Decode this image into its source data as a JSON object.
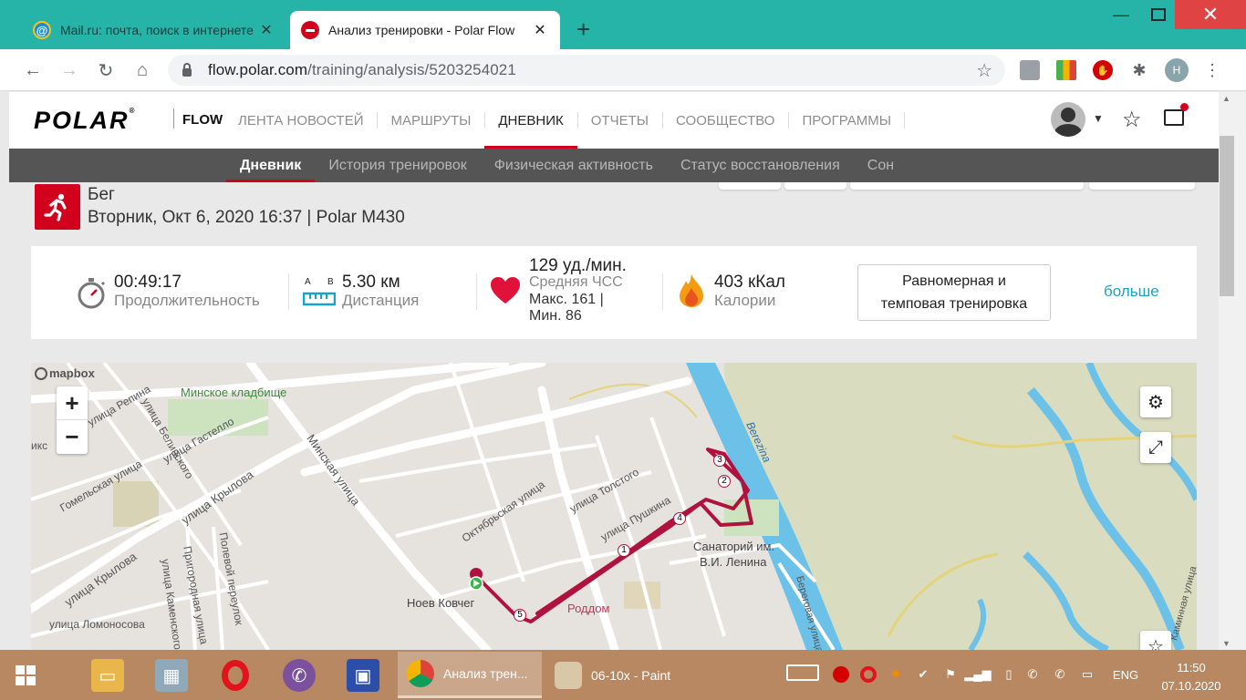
{
  "browser": {
    "tabs": [
      {
        "title": "Mail.ru: почта, поиск в интернете",
        "active": false,
        "favicon": "mailru-icon"
      },
      {
        "title": "Анализ тренировки - Polar Flow",
        "active": true,
        "favicon": "polar-icon"
      }
    ],
    "new_tab": "+",
    "url_host": "flow.polar.com",
    "url_path": "/training/analysis/5203254021",
    "profile_initial": "Н"
  },
  "polar": {
    "logo": "POLAR",
    "flow": "FLOW",
    "main_nav": [
      "ЛЕНТА НОВОСТЕЙ",
      "МАРШРУТЫ",
      "ДНЕВНИК",
      "ОТЧЕТЫ",
      "СООБЩЕСТВО",
      "ПРОГРАММЫ"
    ],
    "main_nav_active": "ДНЕВНИК",
    "sub_nav": [
      "Дневник",
      "История тренировок",
      "Физическая активность",
      "Статус восстановления",
      "Сон"
    ],
    "sub_nav_active": "Дневник",
    "brand_color": "#d1001c"
  },
  "session": {
    "sport": "Бег",
    "datetime_device": "Вторник, Окт 6, 2020 16:37 | Polar M430"
  },
  "summary": {
    "duration_value": "00:49:17",
    "duration_label": "Продолжительность",
    "distance_value": "5.30 км",
    "distance_label": "Дистанция",
    "distance_ab_a": "A",
    "distance_ab_b": "B",
    "hr_value": "129 уд./мин.",
    "hr_label": "Средняя ЧСС",
    "hr_max": "Макс. 161  |",
    "hr_min": "Мин. 86",
    "calories_value": "403 кКал",
    "calories_label": "Калории",
    "training_type_line1": "Равномерная и",
    "training_type_line2": "темповая тренировка",
    "more": "больше"
  },
  "map": {
    "attribution": "mapbox",
    "zoom_in": "+",
    "zoom_out": "−",
    "labels": {
      "cemetery": "Минское кладбище",
      "gastello": "улица Гастелло",
      "belinskogo": "улица Белинского",
      "repina": "улица Репина",
      "gomelskaya": "Гомельская улица",
      "krylova1": "улица Крылова",
      "krylova2": "улица Крылова",
      "minskaya": "Минская улица",
      "polevoy": "Полевой переулок",
      "prigorodnaya": "Пригородная улица",
      "kamenskogo": "улица Каменского",
      "lomonosova": "улица Ломоносова",
      "oktyabrskaya": "Октябрьская улица",
      "tolstogo": "улица Толстого",
      "pushkina": "улица Пушкина",
      "noev": "Ноев Ковчег",
      "roddom": "Роддом",
      "sanatoriy_1": "Санаторий им.",
      "sanatoriy_2": "В.И. Ленина",
      "beregovaya": "Береговая улица",
      "berezina": "Berezina",
      "kiks": "икс",
      "right_street": "Каминная улица"
    },
    "km_markers": [
      "1",
      "2",
      "3",
      "4",
      "5"
    ],
    "route_color": "#b0123f"
  },
  "taskbar": {
    "apps": [
      {
        "label": "Анализ трен...",
        "active": true
      },
      {
        "label": "06-10x - Paint",
        "active": false
      }
    ],
    "lang": "ENG",
    "time": "11:50",
    "date": "07.10.2020"
  }
}
